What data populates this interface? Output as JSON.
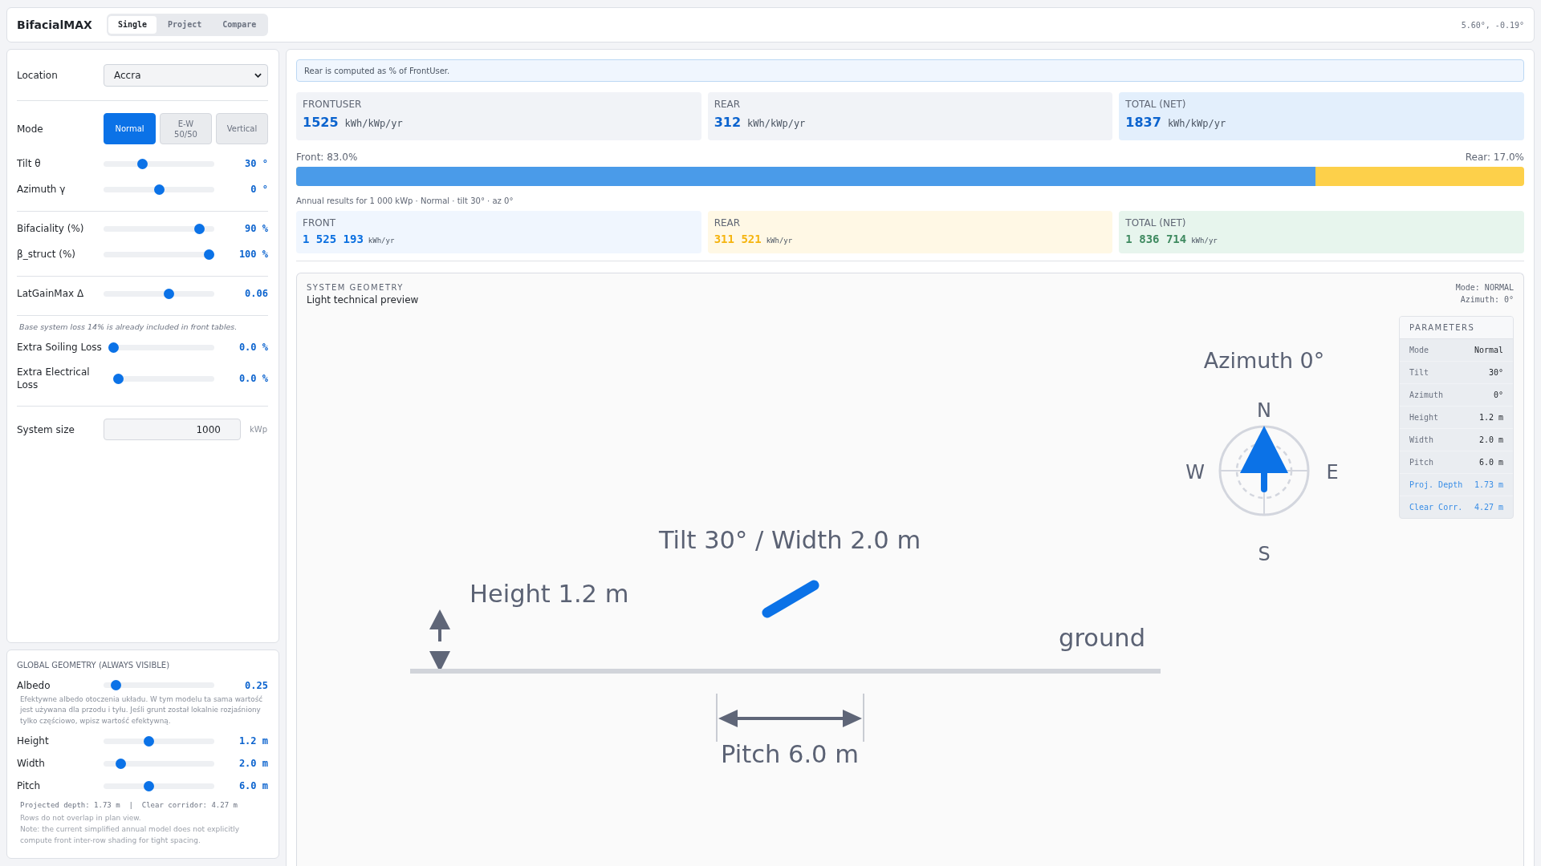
{
  "app": {
    "brand": "BifacialMAX",
    "tabs": [
      {
        "label": "Single",
        "selected": true
      },
      {
        "label": "Project",
        "selected": false
      },
      {
        "label": "Compare",
        "selected": false
      }
    ],
    "coordinates": "5.60°, -0.19°"
  },
  "inputs": {
    "location": {
      "label": "Location",
      "value": "Accra"
    },
    "mode": {
      "label": "Mode",
      "options": [
        {
          "label": "Normal",
          "selected": true
        },
        {
          "label": "E-W 50/50",
          "selected": false
        },
        {
          "label": "Vertical",
          "selected": false
        }
      ]
    },
    "slider_groups": [
      [
        {
          "label": "Tilt θ",
          "level": 0.333,
          "value": "30 °"
        },
        {
          "label": "Azimuth γ",
          "level": 0.5,
          "value": "0 °"
        }
      ],
      [
        {
          "label": "Bifaciality (%)",
          "level": 0.9,
          "value": "90 %"
        },
        {
          "label": "β_struct (%)",
          "level": 1,
          "value": "100 %"
        }
      ],
      [
        {
          "label": "LatGainMax Δ",
          "level": 0.6,
          "value": "0.06"
        }
      ]
    ],
    "loss_note": "Base system loss 14% is already included in front tables.",
    "losses": [
      {
        "label": "Extra Soiling Loss",
        "level": 0,
        "value": "0.0 %"
      },
      {
        "label": "Extra Electrical Loss",
        "level": 0,
        "value": "0.0 %"
      }
    ],
    "system_size": {
      "label": "System size",
      "value": "1000",
      "unit": "kWp"
    }
  },
  "global_geometry": {
    "title": "GLOBAL GEOMETRY (ALWAYS VISIBLE)",
    "albedo": {
      "label": "Albedo",
      "level": 0.07,
      "value": "0.25",
      "help": "Efektywne albedo otoczenia układu. W tym modelu ta sama wartość jest używana dla przodu i tyłu. Jeśli grunt został lokalnie rozjaśniony tylko częściowo, wpisz wartość efektywną."
    },
    "sliders": [
      {
        "label": "Height",
        "level": 0.4,
        "value": "1.2 m"
      },
      {
        "label": "Width",
        "level": 0.12,
        "value": "2.0 m"
      },
      {
        "label": "Pitch",
        "level": 0.4,
        "value": "6.0 m"
      }
    ],
    "summary": "Projected depth: 1.73 m  |  Clear corridor: 4.27 m",
    "status": "Rows do not overlap in plan view.",
    "note": "Note: the current simplified annual model does not explicitly compute front inter-row shading for tight spacing."
  },
  "results": {
    "info": "Rear is computed as % of FrontUser.",
    "specific": [
      {
        "kind": "part",
        "label": "FRONTUSER",
        "value": "1525",
        "unit": "kWh/kWp/yr"
      },
      {
        "kind": "part",
        "label": "REAR",
        "value": "312",
        "unit": "kWh/kWp/yr"
      },
      {
        "kind": "total",
        "label": "TOTAL (NET)",
        "value": "1837",
        "unit": "kWh/kWp/yr"
      }
    ],
    "split": {
      "front_label": "Front: 83.0%",
      "rear_label": "Rear: 17.0%",
      "level": 0.83
    },
    "annual_caption": "Annual results for 1 000 kWp · Normal · tilt 30° · az 0°",
    "annual": [
      {
        "kind": "front",
        "label": "FRONT",
        "value": "1 525 193",
        "unit": "kWh/yr"
      },
      {
        "kind": "rear",
        "label": "REAR",
        "value": "311 521",
        "unit": "kWh/yr"
      },
      {
        "kind": "total",
        "label": "TOTAL (NET)",
        "value": "1 836 714",
        "unit": "kWh/yr"
      }
    ]
  },
  "geometry": {
    "title": "SYSTEM GEOMETRY",
    "subtitle": "Light technical preview",
    "mode": "Mode: NORMAL",
    "azimuth": "Azimuth: 0°",
    "drawing": {
      "azimuth_label": "Azimuth 0°",
      "compass": {
        "n": "N",
        "e": "E",
        "s": "S",
        "w": "W"
      },
      "tilt_width_label": "Tilt 30° / Width 2.0 m",
      "height_label": "Height 1.2 m",
      "ground_label": "ground",
      "pitch_label": "Pitch 6.0 m"
    },
    "parameters": {
      "title": "PARAMETERS",
      "rows": [
        {
          "kind": "input",
          "label": "Mode",
          "value": "Normal"
        },
        {
          "kind": "input",
          "label": "Tilt",
          "value": "30°"
        },
        {
          "kind": "input",
          "label": "Azimuth",
          "value": "0°"
        },
        {
          "kind": "input",
          "label": "Height",
          "value": "1.2 m"
        },
        {
          "kind": "input",
          "label": "Width",
          "value": "2.0 m"
        },
        {
          "kind": "input",
          "label": "Pitch",
          "value": "6.0 m"
        },
        {
          "kind": "derived",
          "label": "Proj. Depth",
          "value": "1.73 m"
        },
        {
          "kind": "derived",
          "label": "Clear Corr.",
          "value": "4.27 m"
        }
      ]
    }
  }
}
